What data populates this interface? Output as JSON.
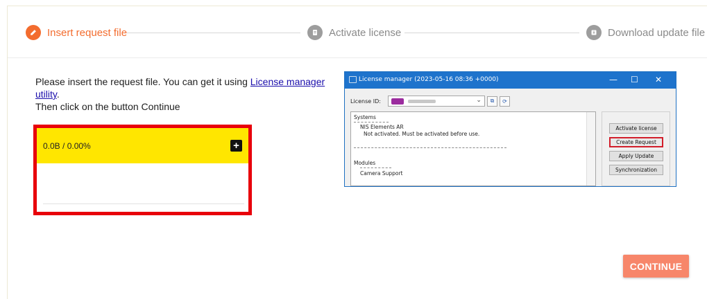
{
  "stepper": {
    "steps": [
      {
        "label": "Insert request file",
        "state": "active",
        "icon": "pencil-icon"
      },
      {
        "label": "Activate license",
        "state": "inactive",
        "icon": "document-icon"
      },
      {
        "label": "Download update file",
        "state": "inactive",
        "icon": "download-icon"
      }
    ],
    "colors": {
      "active": "#f36c2e",
      "inactive": "#9d9d9d"
    }
  },
  "instructions": {
    "text_before_link": "Please insert the request file. You can get it using ",
    "link_text": "License manager utility",
    "text_after_link": ".",
    "line2": "Then click on the button Continue"
  },
  "upload": {
    "status": "0.0B / 0.00%",
    "add_icon": "plus-icon",
    "highlight_color": "#e8000b",
    "bar_color": "#ffe600"
  },
  "license_window": {
    "title": "License manager (2023-05-16 08:36 +0000)",
    "controls": {
      "minimize": "—",
      "maximize": "☐",
      "close": "✕"
    },
    "license_id_label": "License ID:",
    "list": {
      "systems_header": "Systems",
      "system_name": "NIS Elements AR",
      "system_status": "Not activated. Must be activated before use.",
      "modules_header": "Modules",
      "module_name": "Camera Support"
    },
    "buttons": {
      "activate": "Activate license",
      "create": "Create Request",
      "apply": "Apply Update",
      "sync": "Synchronization"
    }
  },
  "continue_label": "CONTINUE",
  "accent_color": "#f7866a"
}
